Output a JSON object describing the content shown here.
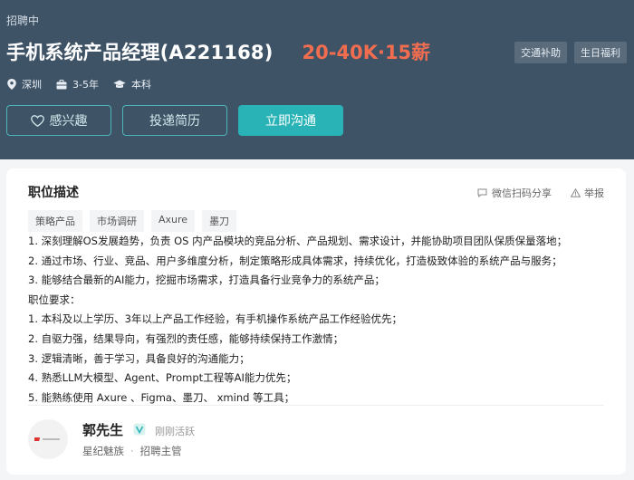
{
  "header": {
    "status": "招聘中",
    "job_title": "手机系统产品经理(A221168)",
    "salary": "20-40K·15薪",
    "welfare": [
      "交通补助",
      "生日福利"
    ],
    "meta": {
      "location": "深圳",
      "experience": "3-5年",
      "education": "本科"
    },
    "buttons": {
      "interest": "感兴趣",
      "apply": "投递简历",
      "chat": "立即沟通"
    }
  },
  "card": {
    "title": "职位描述",
    "share": "微信扫码分享",
    "report": "举报",
    "tags": [
      "策略产品",
      "市场调研",
      "Axure",
      "墨刀"
    ],
    "description": [
      "1.   深刻理解OS发展趋势，负责 OS 内产品模块的竞品分析、产品规划、需求设计，并能协助项目团队保质保量落地；",
      "2.   通过市场、行业、竞品、用户多维度分析，制定策略形成具体需求，持续优化，打造极致体验的系统产品与服务；",
      "3.   能够结合最新的AI能力，挖掘市场需求，打造具备行业竞争力的系统产品；",
      "职位要求：",
      "1.   本科及以上学历、3年以上产品工作经验，有手机操作系统产品工作经验优先；",
      "2.   自驱力强，结果导向，有强烈的责任感，能够持续保持工作激情；",
      "3.   逻辑清晰，善于学习，具备良好的沟通能力；",
      "4.   熟悉LLM大模型、Agent、Prompt工程等AI能力优先；",
      "5.   能熟练使用 Axure 、Figma、墨刀、 xmind 等工具；"
    ],
    "recruiter": {
      "name": "郭先生",
      "active": "刚刚活跃",
      "company": "星纪魅族",
      "role": "招聘主管",
      "company_separator": "·"
    }
  },
  "colors": {
    "header_bg": "#3f5367",
    "accent": "#2ab3b6",
    "salary": "#f26d50"
  }
}
